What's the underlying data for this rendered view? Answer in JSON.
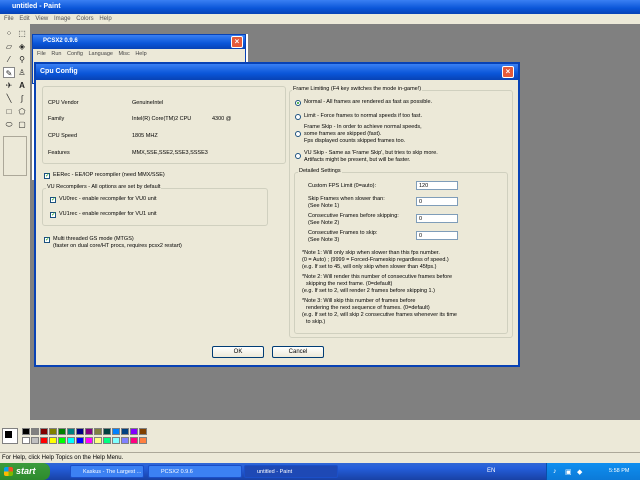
{
  "paint": {
    "title": "untitled - Paint",
    "menu": [
      "File",
      "Edit",
      "View",
      "Image",
      "Colors",
      "Help"
    ],
    "status": "For Help, click Help Topics on the Help Menu.",
    "palette_top": [
      "#000000",
      "#808080",
      "#800000",
      "#808000",
      "#008000",
      "#008080",
      "#000080",
      "#800080",
      "#808040",
      "#004040",
      "#0080ff",
      "#004080",
      "#8000ff",
      "#804000"
    ],
    "palette_bottom": [
      "#ffffff",
      "#c0c0c0",
      "#ff0000",
      "#ffff00",
      "#00ff00",
      "#00ffff",
      "#0000ff",
      "#ff00ff",
      "#ffff80",
      "#00ff80",
      "#80ffff",
      "#8080ff",
      "#ff0080",
      "#ff8040"
    ]
  },
  "pcsx2": {
    "title": "PCSX2 0.9.6",
    "menu": [
      "File",
      "Run",
      "Config",
      "Language",
      "Misc",
      "Help"
    ]
  },
  "cpu_config": {
    "title": "Cpu Config",
    "info": {
      "vendor_label": "CPU Vendor",
      "vendor_value": "GenuineIntel",
      "family_label": "Family",
      "family_value": "Intel(R) Core(TM)2 CPU",
      "family_extra": "4300  @",
      "speed_label": "CPU Speed",
      "speed_value": "1805 MHZ",
      "features_label": "Features",
      "features_value": "MMX,SSE,SSE2,SSE3,SSSE3"
    },
    "eerec_label": "EERec -  EE/IOP recompiler (need MMX/SSE)",
    "vu_group_label": "VU Recompilers - All options are set by default",
    "vu0_label": "VU0rec - enable recompiler for VU0 unit",
    "vu1_label": "VU1rec - enable recompiler for VU1 unit",
    "mtgs_line1": "Multi threaded GS mode (MTGS)",
    "mtgs_line2": "(faster on dual core/HT procs, requires pcsx2 restart)",
    "frame_group_label": "Frame Limiting (F4 key switches the mode in-game!)",
    "normal_label": "Normal - All frames are rendered as fast as possible.",
    "limit_label": "Limit - Force frames to normal speeds if too fast.",
    "frameskip_line1": "Frame Skip - In order to achieve normal speeds,",
    "frameskip_line2": "some frames are skipped (fast).",
    "frameskip_line3": "Fps displayed counts skipped frames too.",
    "vuskip_line1": "VU Skip - Same as 'Frame Skip', but tries to skip more.",
    "vuskip_line2": "Artifacts might be present, but will be faster.",
    "detailed_label": "Detailed Settings",
    "fps_limit_label": "Custom FPS Limit (0=auto):",
    "fps_limit_value": "120",
    "skip_slower_line1": "Skip Frames when slower than:",
    "skip_slower_line2": "(See Note 1)",
    "skip_slower_value": "0",
    "consec_before_line1": "Consecutive Frames before skipping:",
    "consec_before_line2": "(See Note 2)",
    "consec_before_value": "0",
    "consec_skip_line1": "Consecutive Frames to skip:",
    "consec_skip_line2": "(See Note 3)",
    "consec_skip_value": "0",
    "note1": [
      "*Note 1: Will only skip when slower than this fps number.",
      "(0 = Auto) ; (9999 = Forced-Frameskip regardless of speed.)",
      "(e.g. If set to 45, will only skip when slower than 45fps.)"
    ],
    "note2": [
      "*Note 2: Will render this number of consecutive frames before",
      "skipping the next frame. (0=default)",
      "(e.g. If set to 2, will render 2 frames before skipping 1.)"
    ],
    "note3": [
      "*Note 3: Will skip this number of frames before",
      "rendering the next sequence of frames. (0=default)",
      "(e.g. If set to 2, will skip 2 consecutive frames whenever its time",
      "to skip.)"
    ],
    "ok_label": "OK",
    "cancel_label": "Cancel"
  },
  "taskbar": {
    "start": "start",
    "tasks": [
      "Kaskus - The Largest ...",
      "PCSX2 0.9.6",
      "untitled - Paint"
    ],
    "lang": "EN",
    "time": "5:58 PM"
  }
}
